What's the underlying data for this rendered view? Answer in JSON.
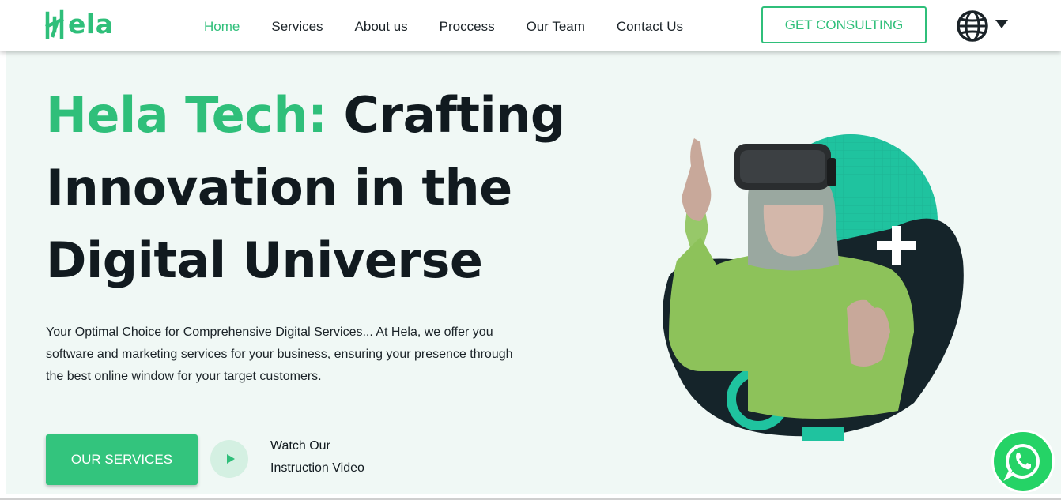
{
  "brand": {
    "logo_text": "ela",
    "logo_icon": "hela-h-icon",
    "accent_color": "#2fbf7a",
    "dark_color": "#111a1f"
  },
  "nav": {
    "items": [
      {
        "label": "Home",
        "active": true
      },
      {
        "label": "Services",
        "active": false
      },
      {
        "label": "About us",
        "active": false
      },
      {
        "label": "Proccess",
        "active": false
      },
      {
        "label": "Our Team",
        "active": false
      },
      {
        "label": "Contact Us",
        "active": false
      }
    ],
    "consult_label": "GET CONSULTING",
    "language_icon": "globe-icon"
  },
  "hero": {
    "title_accent": "Hela Tech:",
    "title_line1_rest": "Crafting",
    "title_line2": "Innovation in the",
    "title_line3": "Digital Universe",
    "description": "Your Optimal Choice for Comprehensive Digital Services... At Hela, we offer you software and marketing services for your business, ensuring your presence through the best online window for your target customers.",
    "services_button": "OUR SERVICES",
    "watch_line1": "Watch Our",
    "watch_line2": "Instruction Video",
    "play_icon": "play-icon"
  },
  "floating": {
    "whatsapp_icon": "whatsapp-icon"
  }
}
